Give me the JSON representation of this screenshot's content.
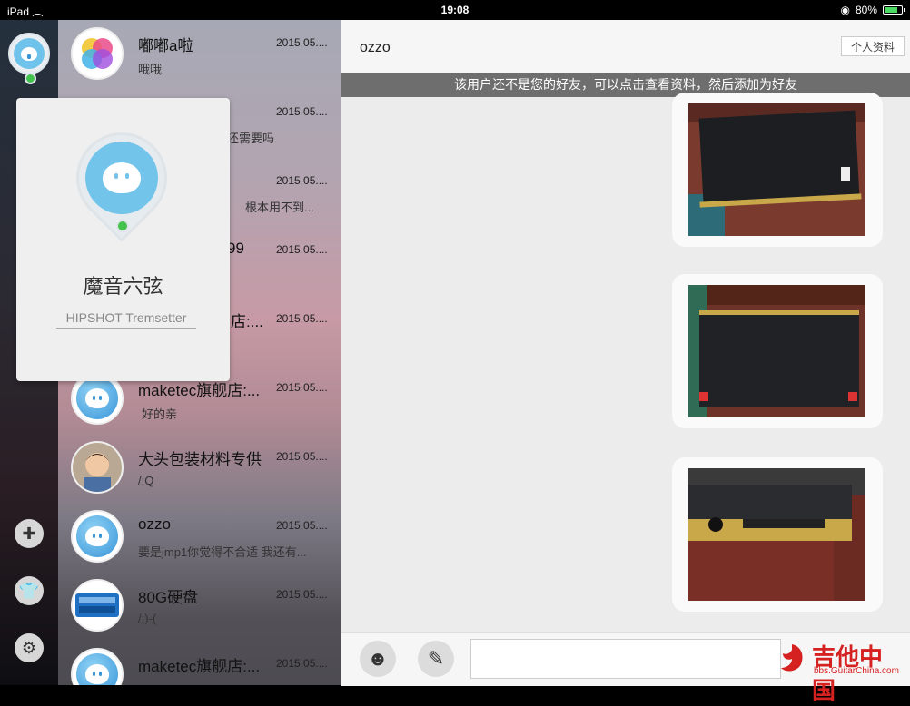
{
  "status_bar": {
    "device": "iPad",
    "time": "19:08",
    "battery": "80%",
    "battery_fraction": 0.8
  },
  "sidebar": {
    "buttons": [
      {
        "icon": "chat-add-icon"
      },
      {
        "icon": "shirt-icon"
      },
      {
        "icon": "gear-icon"
      }
    ]
  },
  "conversations": [
    {
      "name": "嘟嘟a啦",
      "date": "2015.05....",
      "msg": "哦哦",
      "avatar": "game-center-icon"
    },
    {
      "name": "",
      "date": "2015.05....",
      "msg": "还需要吗",
      "avatar": "qq-icon"
    },
    {
      "name": "",
      "date": "2015.05....",
      "msg": "根本用不到...",
      "avatar": "qq-icon"
    },
    {
      "name": "99",
      "date": "2015.05....",
      "msg": "",
      "avatar": "qq-icon"
    },
    {
      "name": "店:...",
      "date": "2015.05....",
      "msg": "",
      "avatar": "qq-icon"
    },
    {
      "name": "maketec旗舰店:...",
      "date": "2015.05....",
      "msg": "好的亲",
      "avatar": "qq-icon"
    },
    {
      "name": "大头包装材料专供",
      "date": "2015.05....",
      "msg": "/:Q",
      "avatar": "child-photo"
    },
    {
      "name": "ozzo",
      "date": "2015.05....",
      "msg": "要是jmp1你觉得不合适  我还有...",
      "avatar": "qq-icon"
    },
    {
      "name": "80G硬盘",
      "date": "2015.05....",
      "msg": "/:)-(",
      "avatar": "blue-badge"
    },
    {
      "name": "maketec旗舰店:...",
      "date": "2015.05....",
      "msg": "",
      "avatar": "qq-icon"
    }
  ],
  "profile_popover": {
    "name": "魔音六弦",
    "signature": "HIPSHOT Tremsetter"
  },
  "chat": {
    "title": "ozzo",
    "profile_button": "个人资料",
    "notice": "该用户还不是您的好友，可以点击查看资料，然后添加为好友",
    "messages": [
      {
        "type": "image",
        "desc": "black-device-photo-1"
      },
      {
        "type": "image",
        "desc": "black-device-photo-2"
      },
      {
        "type": "image",
        "desc": "device-front-photo"
      }
    ],
    "input_value": ""
  },
  "watermark": {
    "title": "吉他中国",
    "url": "bbs.GuitarChina.com"
  }
}
